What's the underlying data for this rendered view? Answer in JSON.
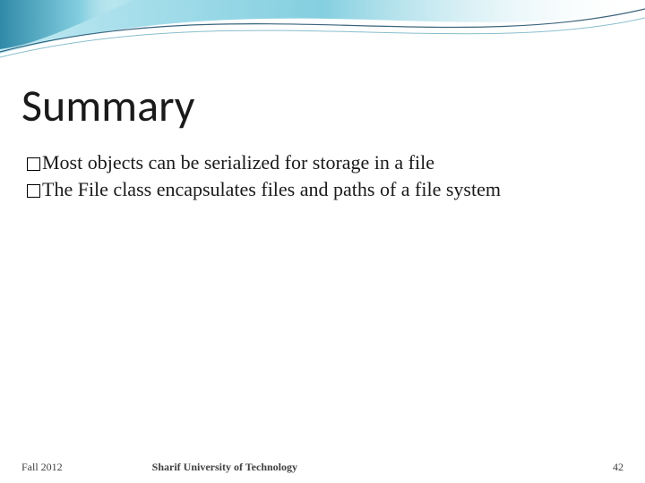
{
  "title": "Summary",
  "bullets": [
    "Most objects can be serialized for storage in a file",
    "The File class encapsulates files and paths of a file system"
  ],
  "footer": {
    "left": "Fall 2012",
    "center": "Sharif University of Technology",
    "right": "42"
  },
  "colors": {
    "wave_light": "#bfe9f2",
    "wave_mid": "#84cfe0",
    "wave_dark": "#2f8aa8",
    "wave_line": "#0a3d5c"
  }
}
